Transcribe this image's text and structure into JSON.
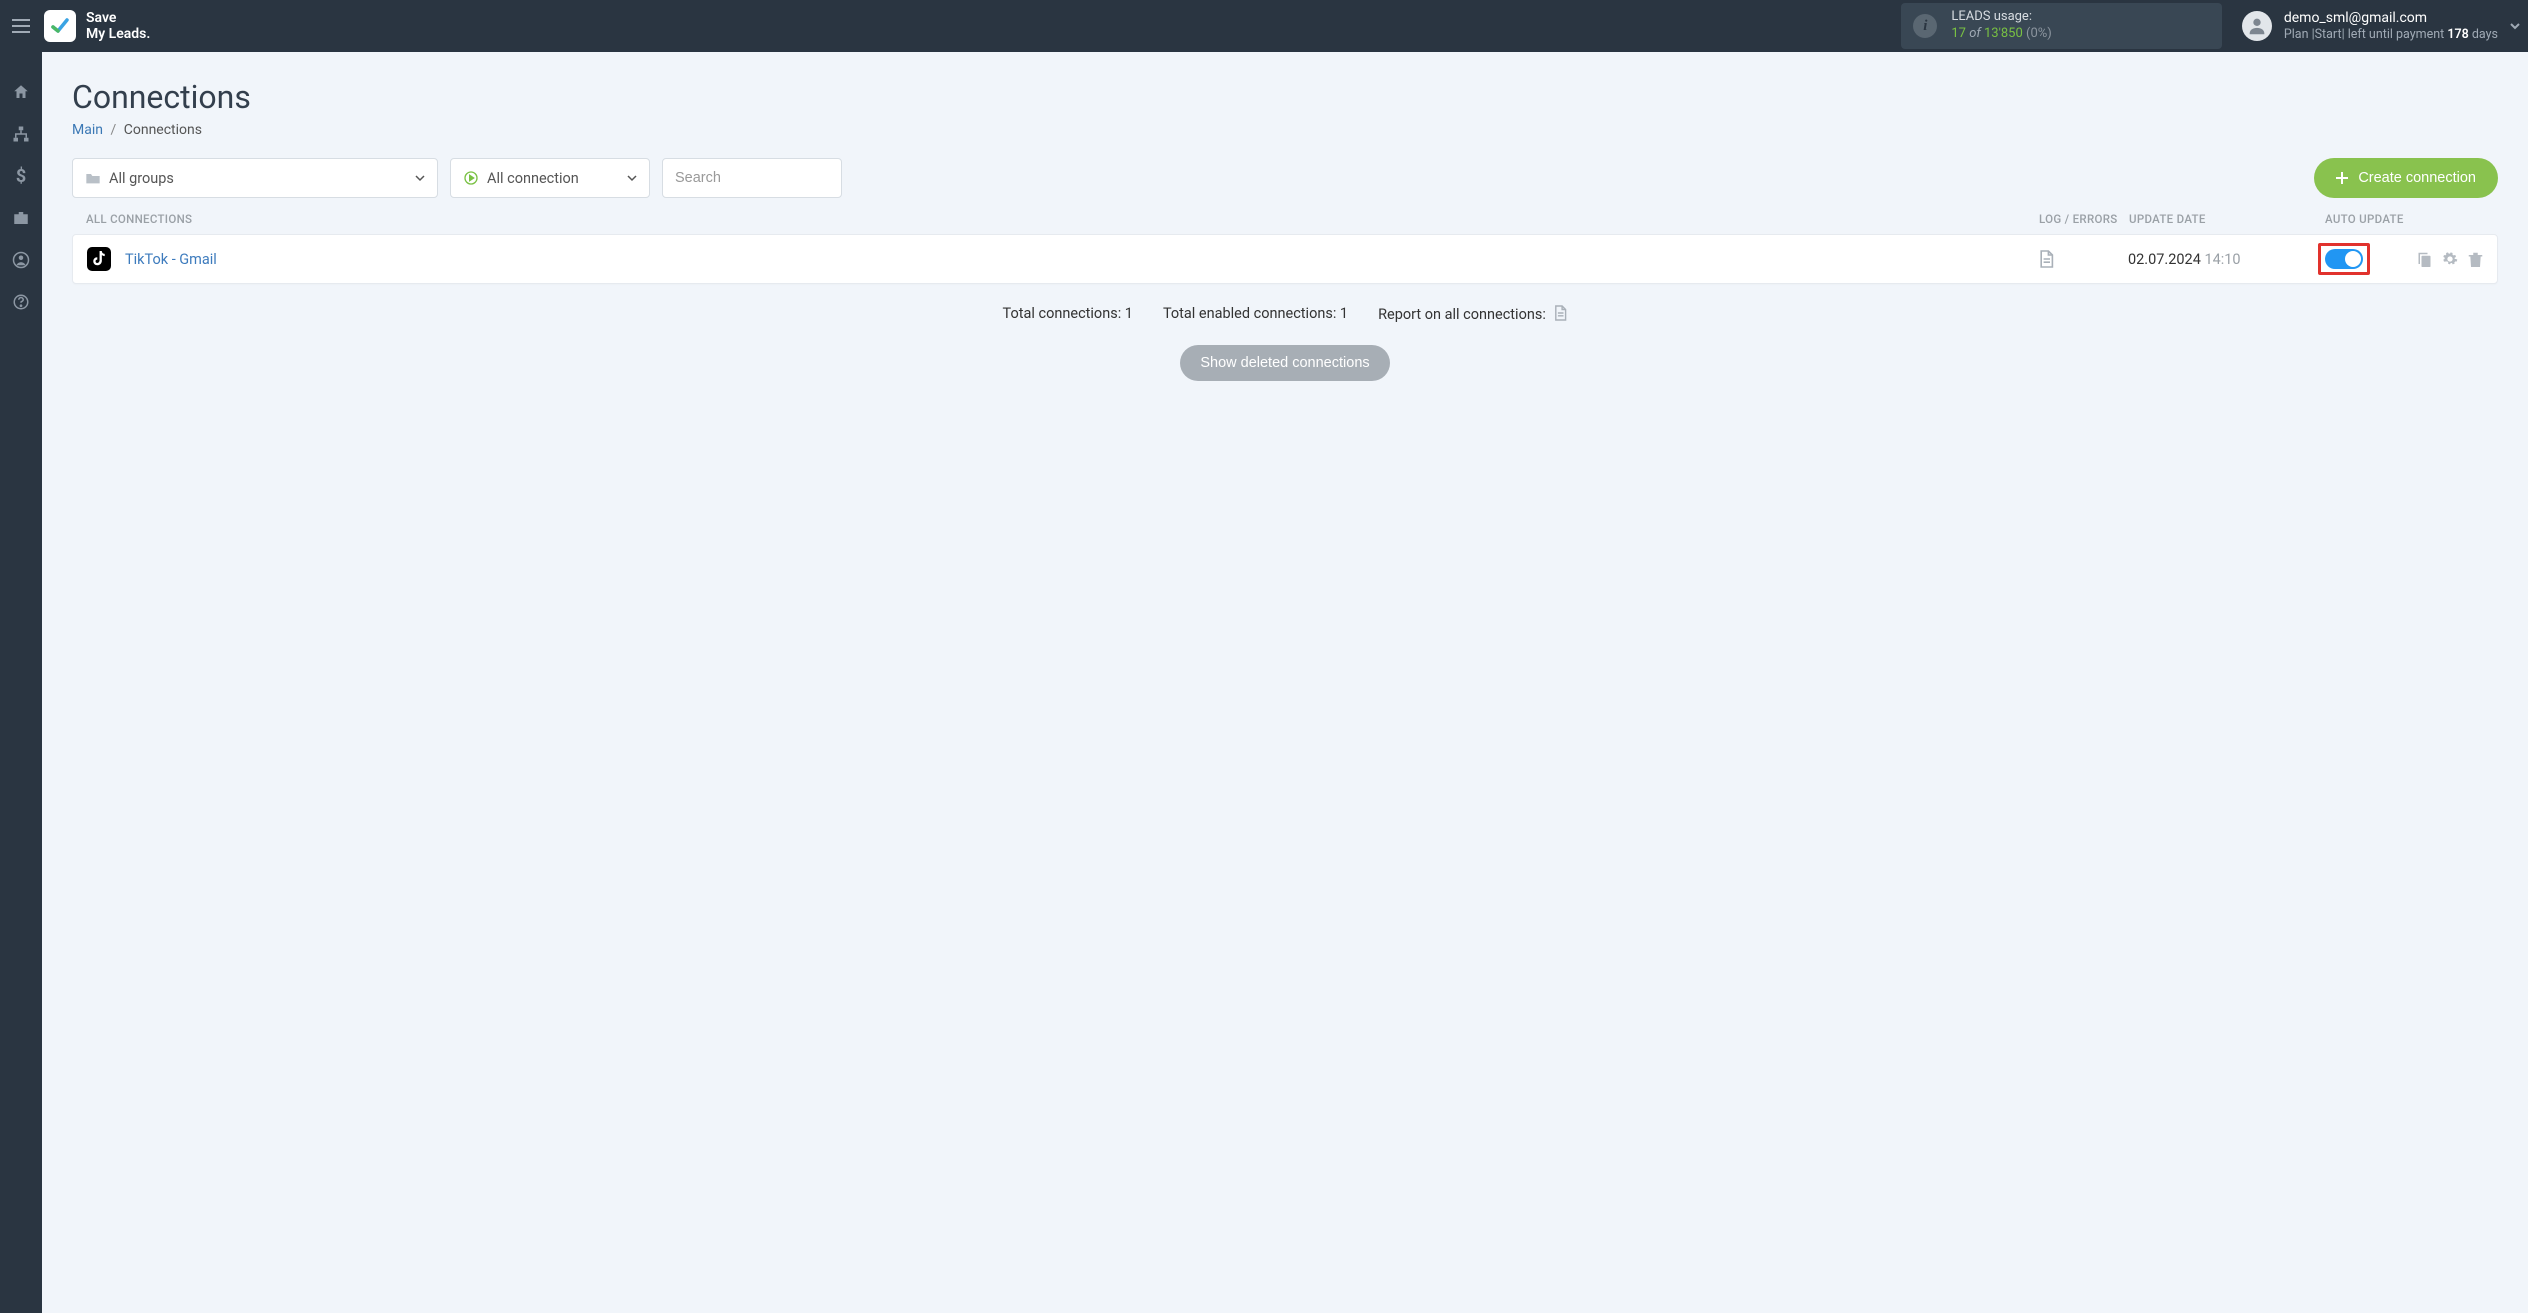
{
  "brand": {
    "line1": "Save",
    "line2": "My Leads."
  },
  "header": {
    "leads_usage_label": "LEADS usage:",
    "leads_used": "17",
    "leads_of": "of",
    "leads_total": "13'850",
    "leads_pct": "(0%)",
    "user_email": "demo_sml@gmail.com",
    "plan_prefix": "Plan |",
    "plan_name": "Start",
    "plan_mid": "| left until payment ",
    "plan_days": "178",
    "plan_suffix": " days"
  },
  "page": {
    "title": "Connections",
    "crumb_main": "Main",
    "crumb_current": "Connections"
  },
  "filters": {
    "groups": "All groups",
    "status": "All connection",
    "search_placeholder": "Search"
  },
  "buttons": {
    "create": "Create connection",
    "show_deleted": "Show deleted connections"
  },
  "thead": {
    "name": "ALL CONNECTIONS",
    "log": "LOG / ERRORS",
    "date": "UPDATE DATE",
    "auto": "AUTO UPDATE"
  },
  "rows": [
    {
      "name": "TikTok - Gmail",
      "date": "02.07.2024",
      "time": "14:10",
      "auto_on": true
    }
  ],
  "summary": {
    "total": "Total connections: 1",
    "enabled": "Total enabled connections: 1",
    "report": "Report on all connections:"
  }
}
